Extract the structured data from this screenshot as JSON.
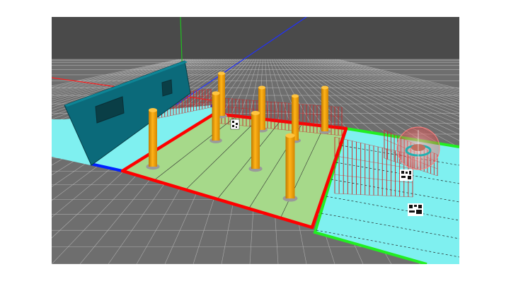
{
  "scene": {
    "background_color": "#ffffff",
    "sky_color": "#4a4a4a",
    "floor_color": "#6e6e6e",
    "grid_line_color": "#c8c8c8",
    "axis_colors": {
      "x": "#ff2020",
      "y": "#20c020",
      "z": "#2030ff"
    },
    "zones": [
      {
        "name": "left-zone",
        "fill": "#7ff0f0",
        "border": "#0022ff"
      },
      {
        "name": "center-zone",
        "fill": "#a6d98a",
        "border": "#ff0000"
      },
      {
        "name": "right-zone",
        "fill": "#7ff0f0",
        "border": "#22ee22"
      }
    ],
    "wall_color": "#0b6a7a",
    "column_color": "#f5a300",
    "rebar_color": "#cc2222",
    "gizmo_color": "#ff6060"
  }
}
